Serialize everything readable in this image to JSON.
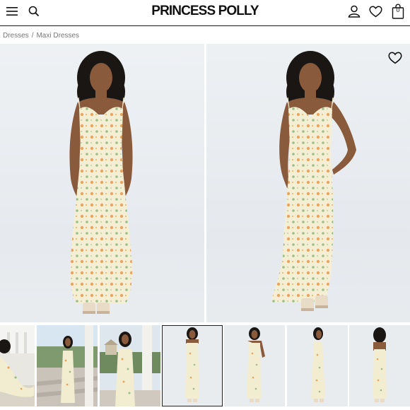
{
  "header": {
    "logo": "PRINCESS POLLY",
    "cart_count": "0",
    "icons": [
      "menu-icon",
      "search-icon",
      "account-icon",
      "heart-icon",
      "bag-icon"
    ]
  },
  "breadcrumb": {
    "items": [
      "Dresses",
      "Maxi Dresses"
    ],
    "separator": "/"
  },
  "gallery": {
    "main_images": [
      "front-view",
      "front-view-hand-on-hip"
    ],
    "thumbnails": [
      "lifestyle-1",
      "lifestyle-2",
      "lifestyle-3",
      "studio-front",
      "studio-front-2",
      "studio-side",
      "studio-back"
    ],
    "selected_thumbnail": 3
  },
  "colors": {
    "background": "#ffffff",
    "photo_bg": "#e8ebee",
    "dress": "#f3edd0",
    "print": "#e8a35d",
    "leaf": "#9bbf88",
    "skin": "#8a5a3c",
    "hair": "#1a1614"
  }
}
